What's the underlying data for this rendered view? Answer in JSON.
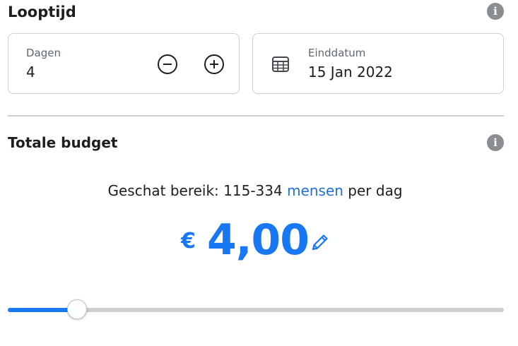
{
  "duration": {
    "title": "Looptijd",
    "days_label": "Dagen",
    "days_value": "4",
    "end_date_label": "Einddatum",
    "end_date_value": "15 Jan 2022",
    "info_glyph": "i"
  },
  "budget": {
    "title": "Totale budget",
    "info_glyph": "i",
    "reach_prefix": "Geschat bereik: 115-334 ",
    "reach_link": "mensen",
    "reach_suffix": " per dag",
    "currency_symbol": "€",
    "amount": "4,00",
    "slider_value_fraction": 0.14
  },
  "icons": {
    "info": "info-icon",
    "minus": "minus-circle-icon",
    "plus": "plus-circle-icon",
    "calendar": "calendar-icon",
    "edit": "pencil-icon"
  },
  "colors": {
    "accent": "#1877f2",
    "link": "#216fdb",
    "text": "#1c1e21",
    "muted": "#606770",
    "border": "#ccd0d5",
    "info_icon": "#8a8d91"
  }
}
